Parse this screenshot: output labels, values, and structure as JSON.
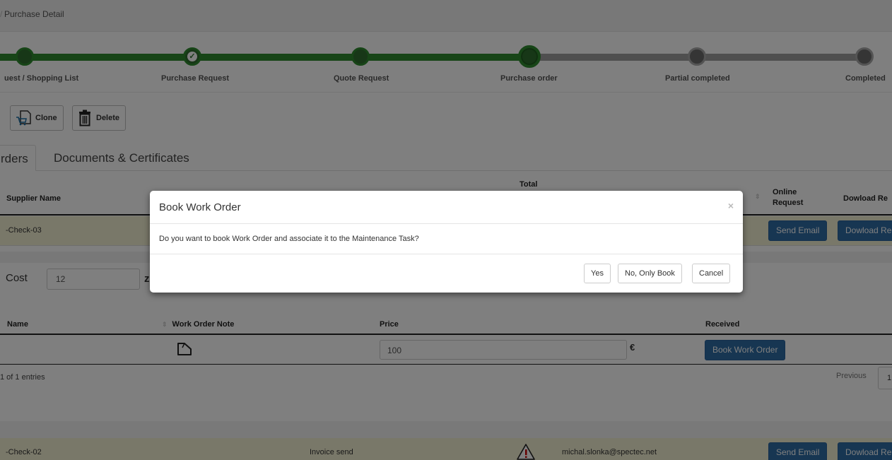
{
  "breadcrumb": {
    "label": "Purchase Detail"
  },
  "progress": {
    "steps": [
      {
        "label": "uest / Shopping List",
        "state": "done"
      },
      {
        "label": "Purchase Request",
        "state": "done"
      },
      {
        "label": "Quote Request",
        "state": "done"
      },
      {
        "label": "Purchase order",
        "state": "current"
      },
      {
        "label": "Partial completed",
        "state": "todo"
      },
      {
        "label": "Completed",
        "state": "todo"
      }
    ]
  },
  "toolbar": {
    "clone_label": "Clone",
    "delete_label": "Delete"
  },
  "tabs": [
    {
      "label": "rders"
    },
    {
      "label": "Documents & Certificates"
    }
  ],
  "orders_table": {
    "columns": {
      "supplier": "Supplier Name",
      "total": "Total",
      "online": "Online Request",
      "download": "Dowload Re"
    },
    "rows": [
      {
        "supplier": "-Check-03",
        "send_label": "Send Email",
        "download_label": "Dowload Re"
      }
    ]
  },
  "cost": {
    "label": "Cost",
    "value": "12",
    "suffix": "z"
  },
  "items_table": {
    "columns": {
      "name": "Name",
      "note": "Work Order Note",
      "price": "Price",
      "received": "Received"
    },
    "rows": [
      {
        "price": "100",
        "currency": "€",
        "book_label": "Book Work Order"
      }
    ],
    "info": "1 of 1 entries",
    "pager_prev": "Previous",
    "page": "1"
  },
  "second_order": {
    "supplier": "-Check-02",
    "status": "Invoice send",
    "email": "michal.slonka@spectec.net",
    "send_label": "Send Email",
    "download_label": "Dowload Re"
  },
  "modal": {
    "title": "Book Work Order",
    "close": "×",
    "message": "Do you want to book Work Order and associate it to the Maintenance Task?",
    "yes_label": "Yes",
    "only_book_label": "No, Only Book",
    "cancel_label": "Cancel"
  },
  "colors": {
    "accent_blue": "#2e6da4",
    "progress_done": "#2e8b2e",
    "progress_todo": "#9e9e9e",
    "row_highlight": "#f3f0d3"
  }
}
